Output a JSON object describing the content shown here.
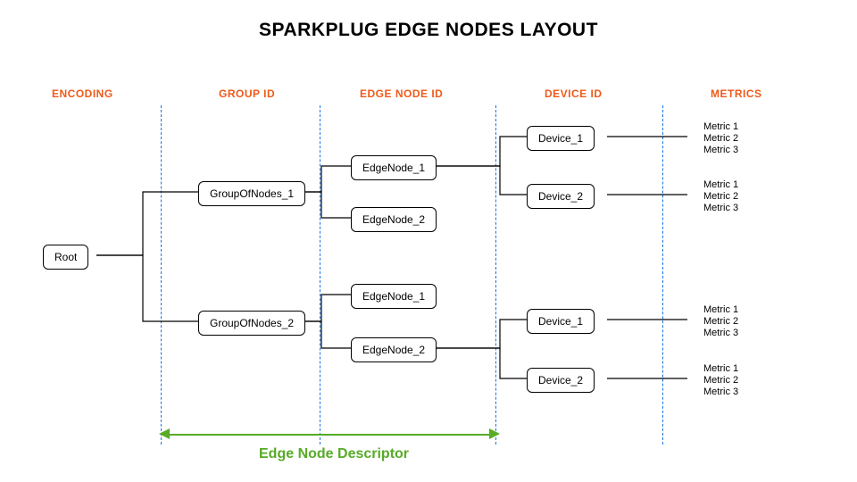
{
  "title": "SPARKPLUG EDGE NODES LAYOUT",
  "columns": {
    "encoding": "ENCODING",
    "group_id": "GROUP ID",
    "edge_node_id": "EDGE NODE ID",
    "device_id": "DEVICE ID",
    "metrics": "METRICS"
  },
  "tree": {
    "root": "Root",
    "group1": "GroupOfNodes_1",
    "group2": "GroupOfNodes_2",
    "g1_edge1": "EdgeNode_1",
    "g1_edge2": "EdgeNode_2",
    "g2_edge1": "EdgeNode_1",
    "g2_edge2": "EdgeNode_2",
    "g1e1_dev1": "Device_1",
    "g1e1_dev2": "Device_2",
    "g2e2_dev1": "Device_1",
    "g2e2_dev2": "Device_2",
    "metric1": "Metric 1",
    "metric2": "Metric 2",
    "metric3": "Metric 3"
  },
  "descriptor_label": "Edge Node Descriptor"
}
